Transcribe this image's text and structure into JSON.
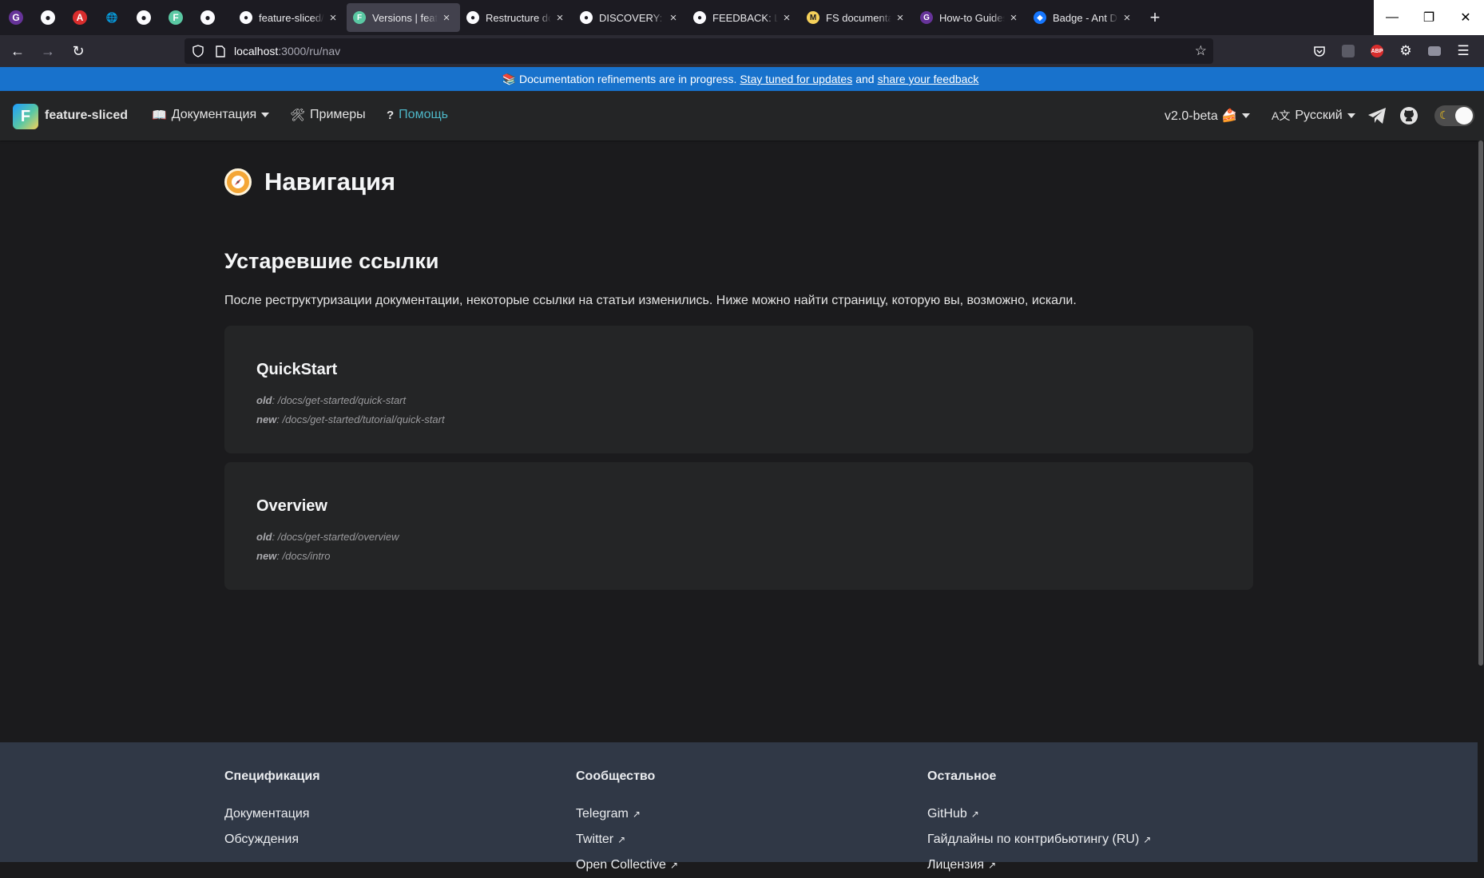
{
  "browser": {
    "pinned_tabs": [
      {
        "icon": "gatsby-icon"
      },
      {
        "icon": "github-icon"
      },
      {
        "icon": "acrobat-icon"
      },
      {
        "icon": "globe-icon"
      },
      {
        "icon": "github-icon"
      },
      {
        "icon": "feature-sliced-icon"
      },
      {
        "icon": "github-icon"
      }
    ],
    "tabs": [
      {
        "title": "feature-sliced/documentation",
        "icon": "github-icon",
        "active": false
      },
      {
        "title": "Versions | feature-sliced",
        "icon": "feature-sliced-icon",
        "active": true
      },
      {
        "title": "Restructure documentation",
        "icon": "github-icon",
        "active": false
      },
      {
        "title": "DISCOVERY: Refine UX",
        "icon": "github-icon",
        "active": false
      },
      {
        "title": "FEEDBACK: Learn \"navigation\"",
        "icon": "github-icon",
        "active": false
      },
      {
        "title": "FS documentation refinement",
        "icon": "miro-icon",
        "active": false
      },
      {
        "title": "How-to Guides | Gatsby",
        "icon": "gatsby-icon",
        "active": false
      },
      {
        "title": "Badge - Ant Design",
        "icon": "antd-icon",
        "active": false
      }
    ],
    "url_host": "localhost",
    "url_path": ":3000/ru/nav"
  },
  "announcement": {
    "emoji": "📚",
    "text_before": "Documentation refinements are in progress.",
    "link1": "Stay tuned for updates",
    "middle": "and",
    "link2": "share your feedback"
  },
  "navbar": {
    "logo_letter": "F",
    "brand": "feature-sliced",
    "docs_icon": "📖",
    "docs": "Документация",
    "examples_icon": "🛠",
    "examples": "Примеры",
    "help_icon": "?",
    "help": "Помощь",
    "version": "v2.0-beta 🍰",
    "lang_icon": "A文",
    "lang": "Русский",
    "moon": "☾"
  },
  "main": {
    "title": "Навигация",
    "section_heading": "Устаревшие ссылки",
    "description": "После реструктуризации документации, некоторые ссылки на статьи изменились. Ниже можно найти страницу, которую вы, возможно, искали.",
    "cards": [
      {
        "title": "QuickStart",
        "old_label": "old",
        "old_path": ": /docs/get-started/quick-start",
        "new_label": "new",
        "new_path": ": /docs/get-started/tutorial/quick-start"
      },
      {
        "title": "Overview",
        "old_label": "old",
        "old_path": ": /docs/get-started/overview",
        "new_label": "new",
        "new_path": ": /docs/intro"
      }
    ]
  },
  "footer": {
    "columns": [
      {
        "heading": "Спецификация",
        "items": [
          {
            "label": "Документация",
            "external": false
          },
          {
            "label": "Обсуждения",
            "external": false
          }
        ]
      },
      {
        "heading": "Сообщество",
        "items": [
          {
            "label": "Telegram",
            "external": true
          },
          {
            "label": "Twitter",
            "external": true
          },
          {
            "label": "Open Collective",
            "external": true
          }
        ]
      },
      {
        "heading": "Остальное",
        "items": [
          {
            "label": "GitHub",
            "external": true
          },
          {
            "label": "Гайдлайны по контрибьютингу (RU)",
            "external": true
          },
          {
            "label": "Лицензия",
            "external": true
          }
        ]
      }
    ],
    "external_glyph": "↗"
  }
}
